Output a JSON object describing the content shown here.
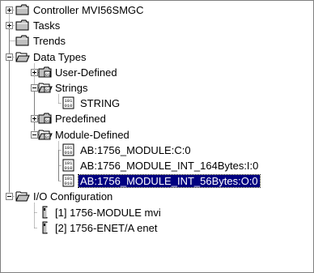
{
  "tree": [
    {
      "label": "Controller MVI56SMGC",
      "icon": "folder-icon",
      "state": "collapsed",
      "level": 0
    },
    {
      "label": "Tasks",
      "icon": "folder-icon",
      "state": "collapsed",
      "level": 0
    },
    {
      "label": "Trends",
      "icon": "folder-icon",
      "state": "leaf",
      "level": 0
    },
    {
      "label": "Data Types",
      "icon": "open-folder-icon",
      "state": "expanded",
      "level": 0
    },
    {
      "label": "User-Defined",
      "icon": "datatype-folder-icon",
      "state": "collapsed",
      "level": 1
    },
    {
      "label": "Strings",
      "icon": "datatype-folder-open-icon",
      "state": "expanded",
      "level": 1
    },
    {
      "label": "STRING",
      "icon": "binary-tag-icon",
      "state": "leaf",
      "level": 2
    },
    {
      "label": "Predefined",
      "icon": "datatype-folder-icon",
      "state": "collapsed",
      "level": 1
    },
    {
      "label": "Module-Defined",
      "icon": "datatype-folder-open-icon",
      "state": "expanded",
      "level": 1
    },
    {
      "label": "AB:1756_MODULE:C:0",
      "icon": "binary-tag-icon",
      "state": "leaf",
      "level": 2
    },
    {
      "label": "AB:1756_MODULE_INT_164Bytes:I:0",
      "icon": "binary-tag-icon",
      "state": "leaf",
      "level": 2
    },
    {
      "label": "AB:1756_MODULE_INT_56Bytes:O:0",
      "icon": "binary-tag-icon",
      "state": "leaf",
      "level": 2,
      "selected": true
    },
    {
      "label": "I/O Configuration",
      "icon": "open-folder-icon",
      "state": "expanded",
      "level": 0
    },
    {
      "label": "[1] 1756-MODULE mvi",
      "icon": "module-card-icon",
      "state": "leaf",
      "level": 1
    },
    {
      "label": "[2] 1756-ENET/A enet",
      "icon": "module-card-icon",
      "state": "leaf",
      "level": 1
    }
  ],
  "colors": {
    "selection_bg": "#000080",
    "selection_fg": "#ffffff",
    "connector": "#808080",
    "folder": "#c0c0c0"
  }
}
